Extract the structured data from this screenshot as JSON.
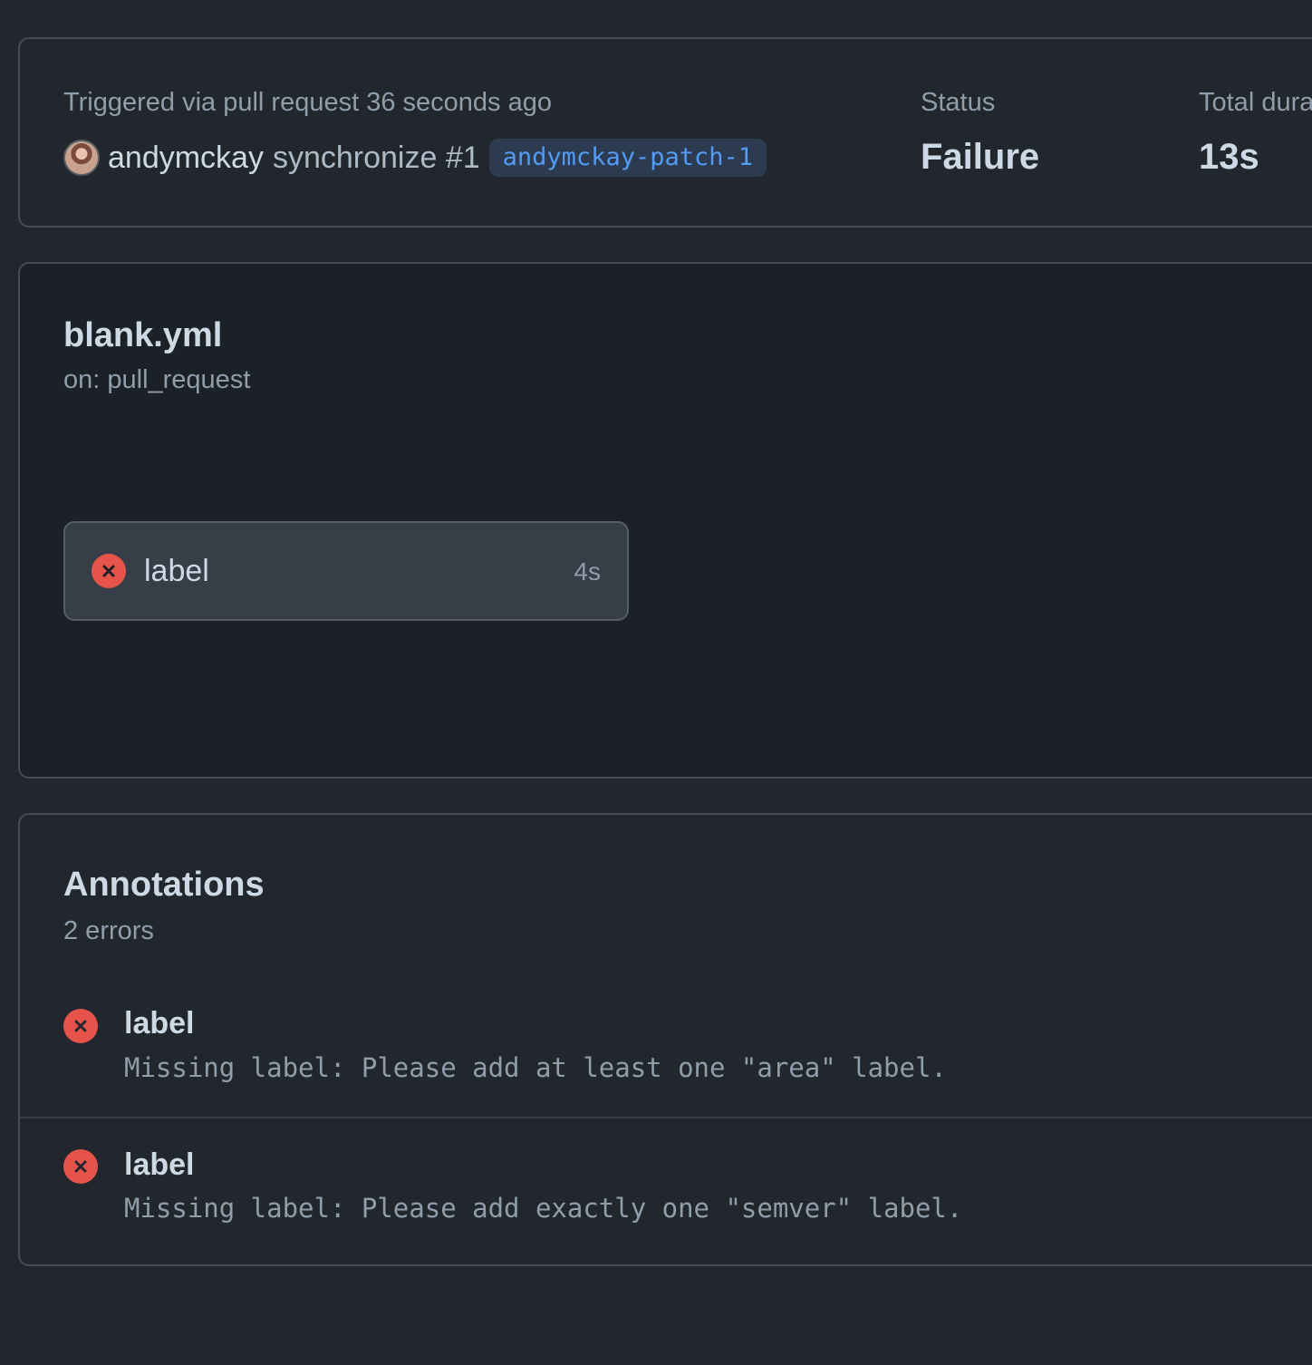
{
  "summary": {
    "trigger_text": "Triggered via pull request 36 seconds ago",
    "actor": "andymckay",
    "event": "synchronize #1",
    "branch": "andymckay-patch-1",
    "status_label": "Status",
    "status_value": "Failure",
    "duration_label": "Total dura",
    "duration_value": "13s"
  },
  "workflow": {
    "file": "blank.yml",
    "trigger": "on: pull_request",
    "jobs": [
      {
        "name": "label",
        "duration": "4s",
        "status": "failure",
        "icon": "x-circle-icon"
      }
    ]
  },
  "annotations": {
    "title": "Annotations",
    "count": "2 errors",
    "items": [
      {
        "name": "label",
        "message": "Missing label: Please add at least one \"area\" label.",
        "icon": "x-circle-icon"
      },
      {
        "name": "label",
        "message": "Missing label: Please add exactly one \"semver\" label.",
        "icon": "x-circle-icon"
      }
    ]
  },
  "colors": {
    "error": "#e5534b",
    "link": "#539bf5",
    "background": "#22272e"
  }
}
